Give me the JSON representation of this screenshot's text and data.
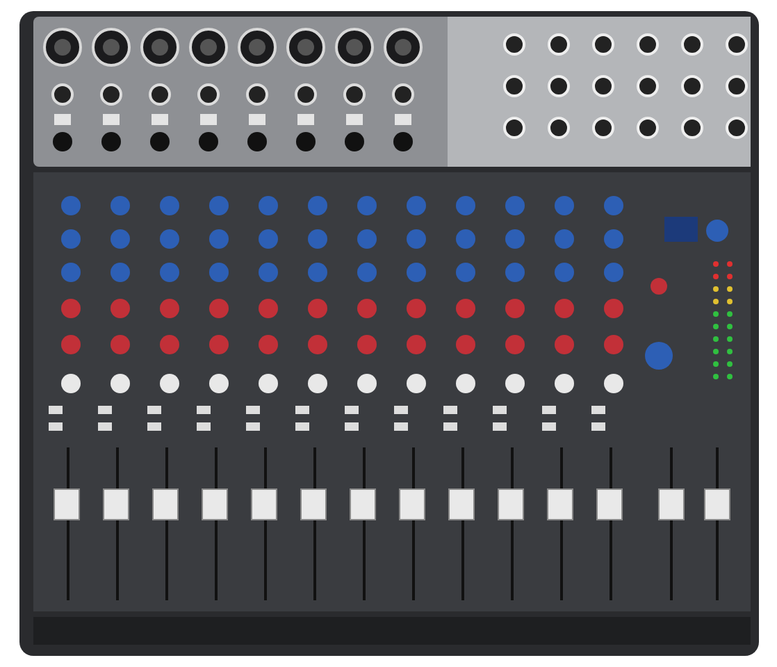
{
  "scene": {
    "kind": "mixer-photo"
  }
}
